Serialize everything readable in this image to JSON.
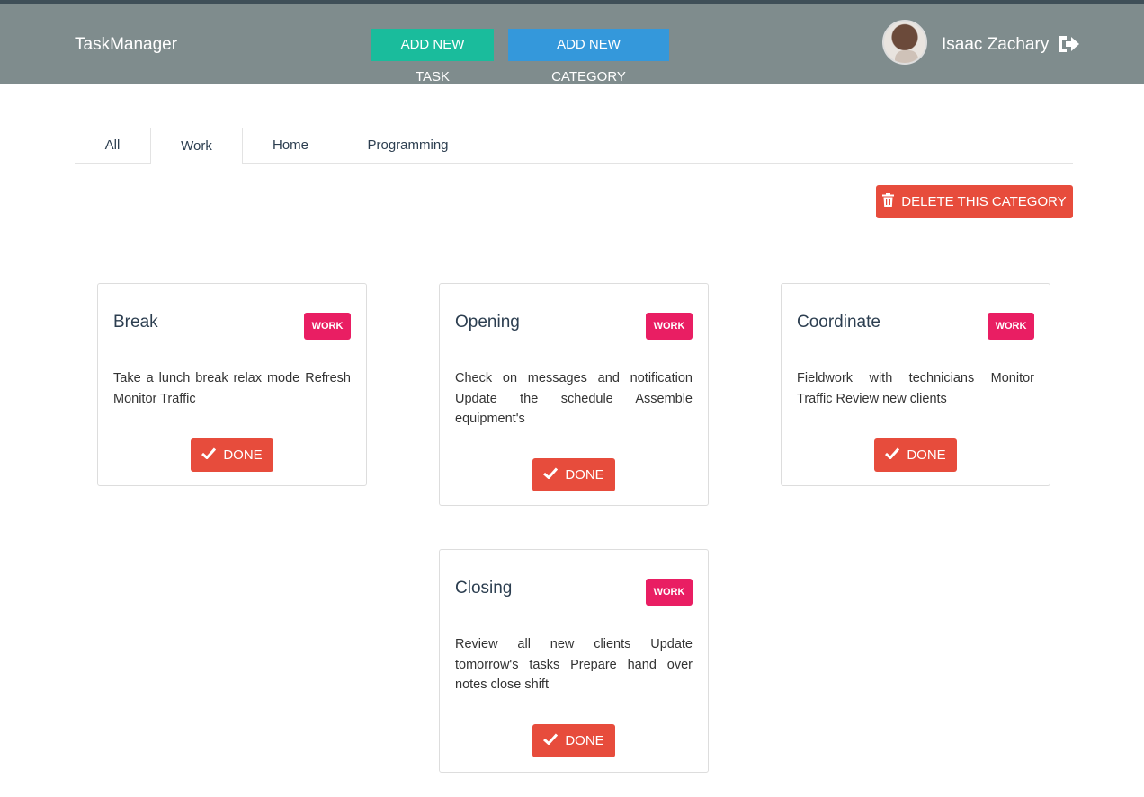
{
  "header": {
    "brand": "TaskManager",
    "add_task_label": "ADD NEW TASK",
    "add_category_label": "ADD NEW CATEGORY",
    "user_name": "Isaac Zachary"
  },
  "tabs": [
    {
      "label": "All"
    },
    {
      "label": "Work",
      "active": true
    },
    {
      "label": "Home"
    },
    {
      "label": "Programming"
    }
  ],
  "delete_category_label": "DELETE THIS CATEGORY",
  "cards": [
    {
      "title": "Break",
      "badge": "WORK",
      "text": "Take a lunch break relax mode Refresh Monitor Traffic",
      "done_label": "DONE"
    },
    {
      "title": "Opening",
      "badge": "WORK",
      "text": "Check on messages and notification Update the schedule Assemble equipment's",
      "done_label": "DONE"
    },
    {
      "title": "Coordinate",
      "badge": "WORK",
      "text": "Fieldwork with technicians Monitor Traffic Review new clients",
      "done_label": "DONE"
    },
    {
      "title": "Closing",
      "badge": "WORK",
      "text": "Review all new clients Update tomorrow's tasks Prepare hand over notes close shift",
      "done_label": "DONE"
    }
  ],
  "colors": {
    "navbar": "#7f8c8d",
    "teal": "#1abc9c",
    "blue": "#3498db",
    "danger": "#e74c3c",
    "badge": "#e91e63"
  },
  "icons": {
    "logout": "sign-out-icon",
    "delete": "trash-icon",
    "done": "check-icon"
  }
}
